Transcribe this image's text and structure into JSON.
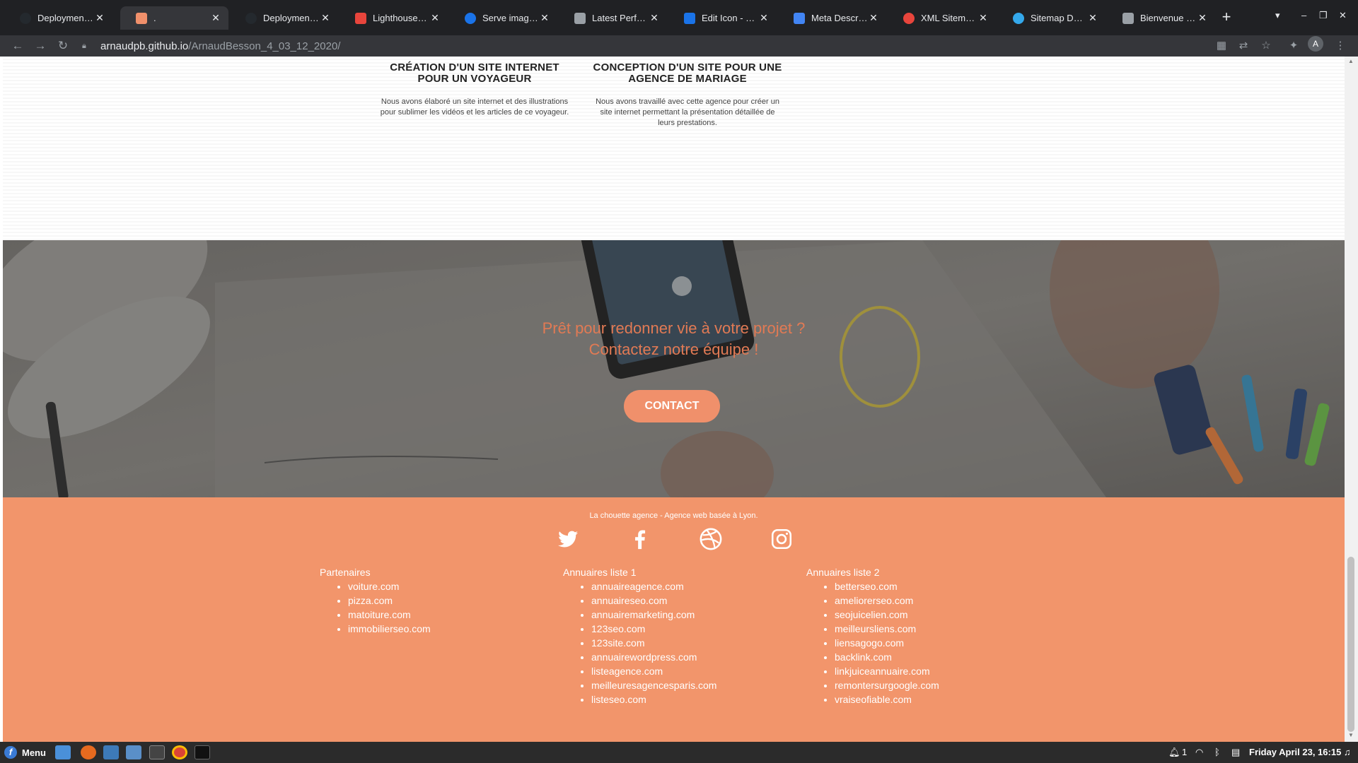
{
  "browser": {
    "tabs": [
      {
        "title": "Deployments · A",
        "favicon_color": "#24292e"
      },
      {
        "title": ".",
        "favicon_color": "#f0906b"
      },
      {
        "title": "Deployments · A",
        "favicon_color": "#24292e"
      },
      {
        "title": "Lighthouse Rep",
        "favicon_color": "#e8453c"
      },
      {
        "title": "Serve images i",
        "favicon_color": "#1a73e8"
      },
      {
        "title": "Latest Perform",
        "favicon_color": "#9aa0a6"
      },
      {
        "title": "Edit Icon - Regu",
        "favicon_color": "#1a73e8"
      },
      {
        "title": "Meta Descriptio",
        "favicon_color": "#4285f4"
      },
      {
        "title": "XML Sitemap: th",
        "favicon_color": "#e8453c"
      },
      {
        "title": "Sitemap Details",
        "favicon_color": "#34a8eb"
      },
      {
        "title": "Bienvenue dans",
        "favicon_color": "#9aa0a6"
      }
    ],
    "new_tab": "+",
    "url_host": "arnaudpb.github.io",
    "url_path": "/ArnaudBesson_4_03_12_2020/",
    "profile_initial": "A"
  },
  "services": [
    {
      "title_line1": "CRÉATION D'UN SITE INTERNET",
      "title_line2": "POUR UN VOYAGEUR",
      "desc_line1": "Nous avons élaboré un site internet et des illustrations",
      "desc_line2": "pour sublimer les vidéos et les articles de ce voyageur.",
      "desc_line3": ""
    },
    {
      "title_line1": "CONCEPTION D'UN SITE POUR UNE",
      "title_line2": "AGENCE DE MARIAGE",
      "desc_line1": "Nous avons travaillé avec cette agence pour créer un",
      "desc_line2": "site internet permettant la présentation détaillée de",
      "desc_line3": "leurs prestations."
    }
  ],
  "hero": {
    "line1": "Prêt pour redonner vie à votre projet ?",
    "line2": "Contactez notre équipe !",
    "button": "CONTACT"
  },
  "footer": {
    "tagline": "La chouette agence - Agence web basée à Lyon.",
    "social": [
      "twitter-icon",
      "facebook-icon",
      "dribbble-icon",
      "instagram-icon"
    ],
    "columns": [
      {
        "heading": "Partenaires",
        "items": [
          "voiture.com",
          "pizza.com",
          "matoiture.com",
          "immobilierseo.com"
        ]
      },
      {
        "heading": "Annuaires liste 1",
        "items": [
          "annuaireagence.com",
          "annuaireseo.com",
          "annuairemarketing.com",
          "123seo.com",
          "123site.com",
          "annuairewordpress.com",
          "listeagence.com",
          "meilleuresagencesparis.com",
          "listeseo.com"
        ]
      },
      {
        "heading": "Annuaires liste 2",
        "items": [
          "betterseo.com",
          "ameliorerseo.com",
          "seojuicelien.com",
          "meilleursliens.com",
          "liensagogo.com",
          "backlink.com",
          "linkjuiceannuaire.com",
          "remontersurgoogle.com",
          "vraiseofiable.com"
        ]
      }
    ]
  },
  "taskbar": {
    "menu_label": "Menu",
    "notification_count": "1",
    "clock": "Friday April 23, 16:15"
  },
  "colors": {
    "accent": "#f2956b",
    "hero_text": "#e27a54"
  }
}
